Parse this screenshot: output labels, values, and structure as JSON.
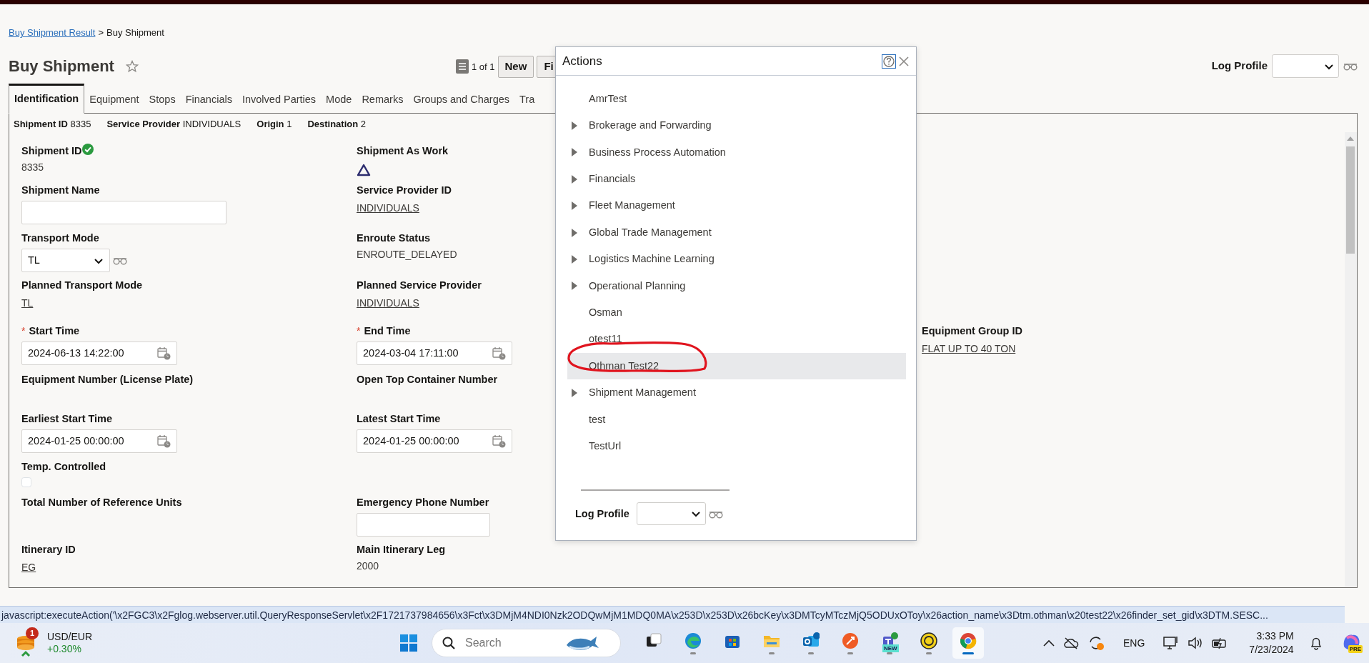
{
  "breadcrumb": {
    "link": "Buy Shipment Result",
    "separator": ">",
    "current": "Buy Shipment"
  },
  "page_title": "Buy Shipment",
  "favorite": false,
  "pager": {
    "text": "1 of 1"
  },
  "toolbar_buttons": [
    "New",
    "Fi"
  ],
  "log_profile": {
    "label": "Log Profile"
  },
  "tabs": [
    {
      "label": "Identification",
      "selected": true
    },
    {
      "label": "Equipment",
      "selected": false
    },
    {
      "label": "Stops",
      "selected": false
    },
    {
      "label": "Financials",
      "selected": false
    },
    {
      "label": "Involved Parties",
      "selected": false
    },
    {
      "label": "Mode",
      "selected": false
    },
    {
      "label": "Remarks",
      "selected": false
    },
    {
      "label": "Groups and Charges",
      "selected": false
    },
    {
      "label": "Tra",
      "selected": false
    }
  ],
  "summary": [
    {
      "label": "Shipment ID",
      "value": "8335"
    },
    {
      "label": "Service Provider",
      "value": "INDIVIDUALS"
    },
    {
      "label": "Origin",
      "value": "1"
    },
    {
      "label": "Destination",
      "value": "2"
    }
  ],
  "form_rows": [
    {
      "cells": [
        {
          "kind": "verified",
          "label": "Shipment ID",
          "value": "8335"
        },
        {
          "kind": "icon",
          "label": "Shipment As Work"
        }
      ]
    },
    {
      "cells": [
        {
          "kind": "input",
          "label": "Shipment Name"
        },
        {
          "kind": "link",
          "label": "Service Provider ID",
          "value": "INDIVIDUALS"
        }
      ]
    },
    {
      "cells": [
        {
          "kind": "select",
          "label": "Transport Mode",
          "value": "TL"
        },
        {
          "kind": "text",
          "label": "Enroute Status",
          "value": "ENROUTE_DELAYED"
        }
      ]
    },
    {
      "cells": [
        {
          "kind": "link",
          "label": "Planned Transport Mode",
          "value": "TL"
        },
        {
          "kind": "link",
          "label": "Planned Service Provider",
          "value": "INDIVIDUALS"
        }
      ]
    },
    {
      "cells": [
        {
          "kind": "date",
          "label": "Start Time",
          "required_mark": "*",
          "value": "2024-06-13 14:22:00"
        },
        {
          "kind": "date",
          "label": "End Time",
          "required_mark": "*",
          "value": "2024-03-04 17:11:00"
        },
        {
          "kind": "link",
          "label": "Equipment Group ID",
          "value": "FLAT UP TO 40 TON"
        }
      ]
    },
    {
      "cells": [
        {
          "kind": "label",
          "label": "Equipment Number (License Plate)"
        },
        {
          "kind": "label",
          "label": "Open Top Container Number"
        }
      ]
    },
    {
      "cells": [
        {
          "kind": "date",
          "label": "Earliest Start Time",
          "value": "2024-01-25 00:00:00"
        },
        {
          "kind": "date",
          "label": "Latest Start Time",
          "value": "2024-01-25 00:00:00"
        }
      ]
    },
    {
      "cells": [
        {
          "kind": "checkbox",
          "label": "Temp. Controlled",
          "checked": false
        },
        null
      ]
    },
    {
      "cells": [
        {
          "kind": "label",
          "label": "Total Number of Reference Units"
        },
        {
          "kind": "input",
          "label": "Emergency Phone Number"
        }
      ]
    },
    {
      "cells": [
        {
          "kind": "link",
          "label": "Itinerary ID",
          "value": "EG"
        },
        {
          "kind": "text",
          "label": "Main Itinerary Leg",
          "value": "2000"
        }
      ]
    }
  ],
  "actions_dialog": {
    "title": "Actions",
    "log_profile_label": "Log Profile",
    "items": [
      {
        "label": "AmrTest",
        "kind": "action",
        "selected": false
      },
      {
        "label": "Brokerage and Forwarding",
        "kind": "group",
        "selected": false
      },
      {
        "label": "Business Process Automation",
        "kind": "group",
        "selected": false
      },
      {
        "label": "Financials",
        "kind": "group",
        "selected": false
      },
      {
        "label": "Fleet Management",
        "kind": "group",
        "selected": false
      },
      {
        "label": "Global Trade Management",
        "kind": "group",
        "selected": false
      },
      {
        "label": "Logistics Machine Learning",
        "kind": "group",
        "selected": false
      },
      {
        "label": "Operational Planning",
        "kind": "group",
        "selected": false
      },
      {
        "label": "Osman",
        "kind": "action",
        "selected": false
      },
      {
        "label": "otest11",
        "kind": "action",
        "selected": false
      },
      {
        "label": "Othman Test22",
        "kind": "action",
        "selected": true
      },
      {
        "label": "Shipment Management",
        "kind": "group",
        "selected": false
      },
      {
        "label": "test",
        "kind": "action",
        "selected": false
      },
      {
        "label": "TestUrl",
        "kind": "action",
        "selected": false
      }
    ]
  },
  "status_url": "javascript:executeAction('\\x2FGC3\\x2Fglog.webserver.util.QueryResponseServlet\\x2F1721737984656\\x3Fct\\x3DMjM4NDI0Nzk2ODQwMjM1MDQ0MA\\x253D\\x253D\\x26bcKey\\x3DMTcyMTczMjQ5ODUxOToy\\x26action_name\\x3Dtm.othman\\x20test22\\x26finder_set_gid\\x3DTM.SESC...",
  "taskbar": {
    "widget": {
      "badge": "1",
      "title": "USD/EUR",
      "change": "+0.30%"
    },
    "search": {
      "placeholder": "Search"
    },
    "apps": [
      {
        "kind": "task_view",
        "running": false,
        "selected": false
      },
      {
        "kind": "edge",
        "running": true,
        "selected": false
      },
      {
        "kind": "store",
        "running": false,
        "selected": false
      },
      {
        "kind": "files",
        "running": true,
        "selected": false
      },
      {
        "kind": "outlook",
        "running": true,
        "selected": false
      },
      {
        "kind": "postman",
        "running": true,
        "selected": false
      },
      {
        "kind": "teams",
        "running": true,
        "selected": false,
        "badge": "NEW"
      },
      {
        "kind": "helper",
        "running": true,
        "selected": false
      },
      {
        "kind": "chrome",
        "running": true,
        "selected": true
      }
    ],
    "tray": {
      "language": "ENG",
      "time": "3:33 PM",
      "date": "7/23/2024",
      "copilot_badge": "PRE"
    }
  }
}
